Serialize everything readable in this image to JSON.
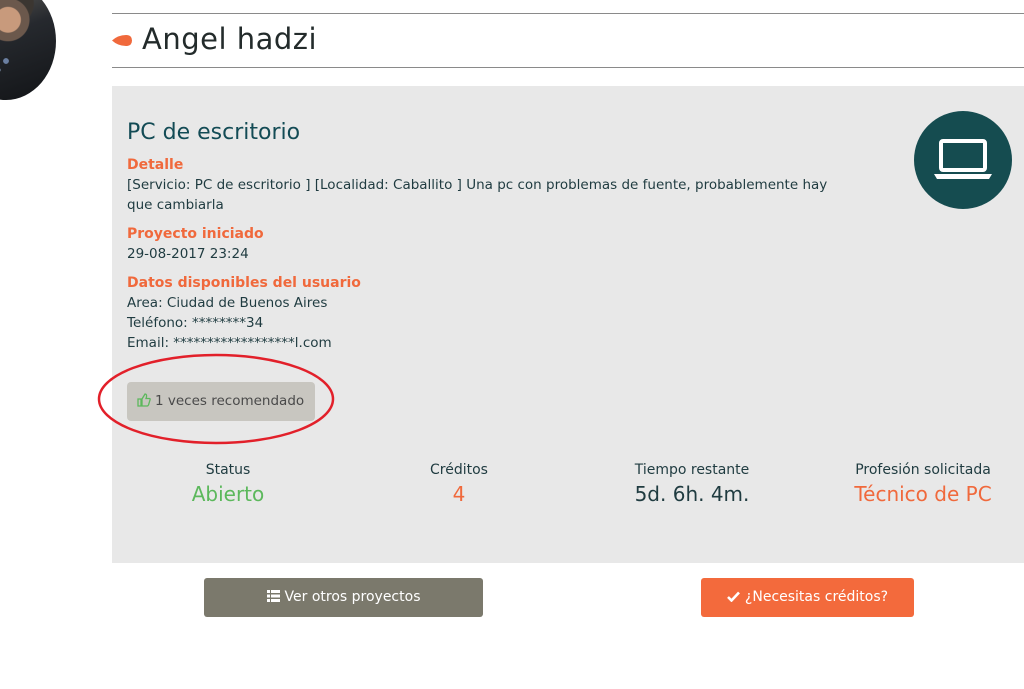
{
  "header": {
    "user_name": "Angel hadzi"
  },
  "project": {
    "title": "PC de escritorio",
    "icon": "laptop-icon",
    "detail_label": "Detalle",
    "detail_text_line1": "[Servicio: PC de escritorio ] [Localidad: Caballito ] Una pc con problemas de fuente, probablemente hay",
    "detail_text_line2": "que cambiarla",
    "started_label": "Proyecto iniciado",
    "started_value": "29-08-2017 23:24",
    "user_data_label": "Datos disponibles del usuario",
    "area": "Area: Ciudad de Buenos Aires",
    "phone": "Teléfono: ********34",
    "email": "Email: ******************l.com",
    "recommended": "1 veces recomendado"
  },
  "stats": [
    {
      "title": "Status",
      "value": "Abierto",
      "color": "#5cb85c"
    },
    {
      "title": "Créditos",
      "value": "4",
      "color": "#f0693c"
    },
    {
      "title": "Tiempo restante",
      "value": "5d. 6h. 4m.",
      "color": "#1f3b40"
    },
    {
      "title": "Profesión solicitada",
      "value": "Técnico de PC",
      "color": "#f0693c"
    }
  ],
  "buttons": {
    "other_projects": "Ver otros proyectos",
    "need_credits": "¿Necesitas créditos?"
  },
  "colors": {
    "accent": "#f0693c",
    "primary_dark": "#154c50",
    "card_bg": "#e8e8e8",
    "button_gray": "#7b796c",
    "button_orange": "#f36a3c"
  }
}
